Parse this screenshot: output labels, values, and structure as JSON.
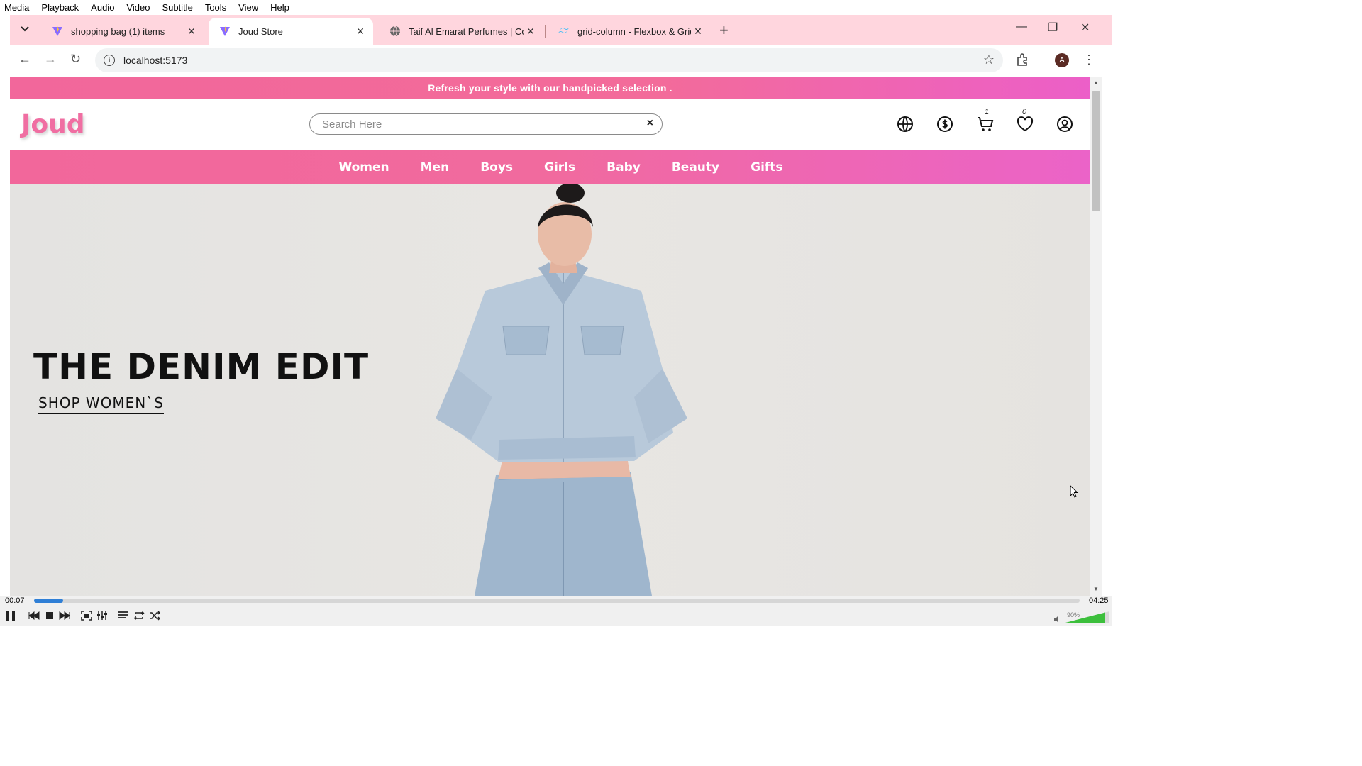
{
  "vlc_menu": [
    "Media",
    "Playback",
    "Audio",
    "Video",
    "Subtitle",
    "Tools",
    "View",
    "Help"
  ],
  "tabs": [
    {
      "title": "shopping bag (1) items",
      "active": false
    },
    {
      "title": "Joud Store",
      "active": true
    },
    {
      "title": "Taif Al Emarat Perfumes | Conti",
      "active": false
    },
    {
      "title": "grid-column - Flexbox & Grid -",
      "active": false
    }
  ],
  "address": {
    "url": "localhost:5173"
  },
  "profile_initial": "A",
  "site": {
    "promo": "Refresh your style with our handpicked selection .",
    "logo": "Joud",
    "search_placeholder": "Search Here",
    "search_clear": "×",
    "cart_count": "1",
    "wishlist_count": "0",
    "nav": [
      "Women",
      "Men",
      "Boys",
      "Girls",
      "Baby",
      "Beauty",
      "Gifts"
    ],
    "hero": {
      "title": "THE DENIM EDIT",
      "cta": "SHOP WOMEN`S"
    }
  },
  "player": {
    "elapsed": "00:07",
    "total": "04:25",
    "progress": 0.028,
    "volume": "90%",
    "accent": "#2f7fd6"
  },
  "colors": {
    "brand": "#f06ea2",
    "banner": "#f2679b",
    "tab_strip": "#ffd6de"
  },
  "icons": [
    "globe-icon",
    "dollar-icon",
    "cart-icon",
    "heart-icon",
    "user-icon"
  ]
}
